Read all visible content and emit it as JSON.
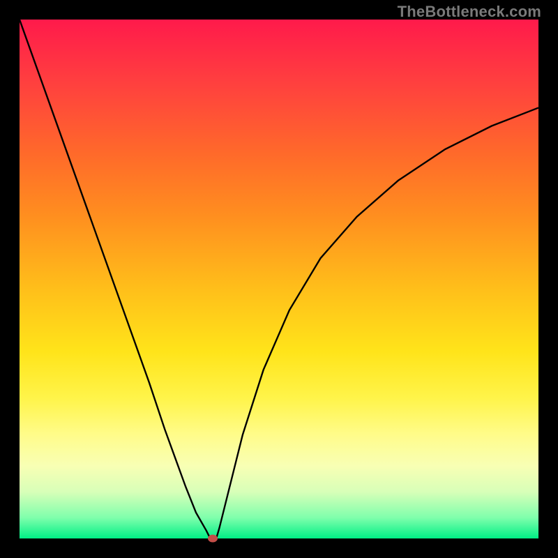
{
  "watermark": "TheBottleneck.com",
  "colors": {
    "page_bg": "#000000",
    "curve": "#000000",
    "marker": "#c44e48",
    "watermark": "#7a7a7a",
    "gradient_top": "#ff1a4b",
    "gradient_bottom": "#00ef86"
  },
  "chart_data": {
    "type": "line",
    "title": "",
    "xlabel": "",
    "ylabel": "",
    "xlim": [
      0,
      100
    ],
    "ylim": [
      0,
      100
    ],
    "grid": false,
    "legend": false,
    "series": [
      {
        "name": "curve",
        "x": [
          0,
          5,
          10,
          15,
          20,
          25,
          28,
          30,
          32,
          34,
          36,
          36.5,
          37,
          37.5,
          38,
          38.5,
          40,
          43,
          47,
          52,
          58,
          65,
          73,
          82,
          91,
          100
        ],
        "y": [
          100,
          86,
          72,
          58,
          44,
          30,
          21,
          15.5,
          10,
          5,
          1.5,
          0.5,
          0,
          0,
          0.3,
          2,
          8,
          20,
          32.5,
          44,
          54,
          62,
          69,
          75,
          79.5,
          83
        ]
      }
    ],
    "marker": {
      "x": 37.2,
      "y": 0
    }
  }
}
